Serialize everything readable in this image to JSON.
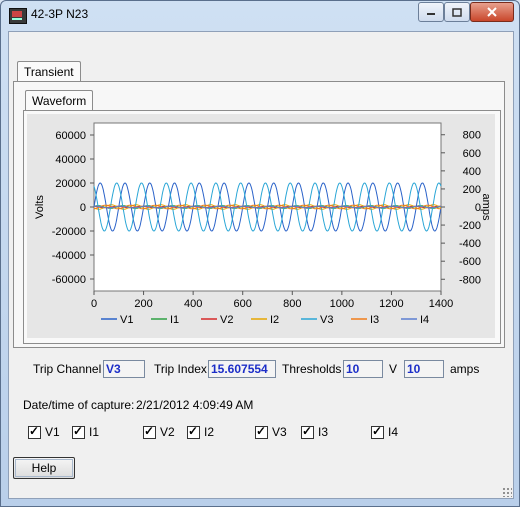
{
  "window": {
    "title": "42-3P N23",
    "controls": [
      "minimize-icon",
      "maximize-icon",
      "close-icon"
    ]
  },
  "tabs": {
    "outer": "Transient",
    "inner": "Waveform"
  },
  "chart_data": {
    "type": "line",
    "left_axis": {
      "label": "Volts",
      "ticks": [
        "60000",
        "40000",
        "20000",
        "0",
        "-20000",
        "-40000",
        "-60000"
      ],
      "ylim": [
        -70000,
        70000
      ]
    },
    "right_axis": {
      "label": "amps",
      "ticks": [
        "800",
        "600",
        "400",
        "200",
        "0",
        "-200",
        "-400",
        "-600",
        "-800"
      ],
      "ylim": [
        -930,
        930
      ]
    },
    "x_axis": {
      "ticks": [
        "0",
        "200",
        "400",
        "600",
        "800",
        "1000",
        "1200",
        "1400"
      ],
      "xlim": [
        0,
        1400
      ]
    },
    "legend": {
      "placement": "bottom"
    },
    "series": [
      {
        "name": "V1",
        "color": "#2a62c9",
        "axis": "left",
        "amplitude": 20000,
        "cycles": 14,
        "phase_deg": 0
      },
      {
        "name": "I1",
        "color": "#2ea043",
        "axis": "right",
        "amplitude": 15,
        "cycles": 14,
        "phase_deg": 30
      },
      {
        "name": "V2",
        "color": "#d62828",
        "axis": "left",
        "amplitude": 600,
        "cycles": 14,
        "phase_deg": 120
      },
      {
        "name": "I2",
        "color": "#e6a700",
        "axis": "right",
        "amplitude": 25,
        "cycles": 14,
        "phase_deg": 200
      },
      {
        "name": "V3",
        "color": "#2aa6d6",
        "axis": "left",
        "amplitude": 20000,
        "cycles": 14,
        "phase_deg": 120
      },
      {
        "name": "I3",
        "color": "#f07d1a",
        "axis": "right",
        "amplitude": 20,
        "cycles": 14,
        "phase_deg": 280
      },
      {
        "name": "I4",
        "color": "#5b7fd0",
        "axis": "right",
        "amplitude": 8,
        "cycles": 14,
        "phase_deg": 60
      }
    ]
  },
  "trip": {
    "channel_label": "Trip Channel",
    "channel_value": "V3",
    "index_label": "Trip Index",
    "index_value": "15.607554",
    "thresholds_label": "Thresholds",
    "threshold_v": "10",
    "v_unit": "V",
    "threshold_a": "10",
    "a_unit": "amps"
  },
  "capture": {
    "label": "Date/time of capture:",
    "value": "2/21/2012 4:09:49 AM"
  },
  "checkboxes": [
    {
      "label": "V1",
      "checked": true
    },
    {
      "label": "I1",
      "checked": true
    },
    {
      "label": "V2",
      "checked": true
    },
    {
      "label": "I2",
      "checked": true
    },
    {
      "label": "V3",
      "checked": true
    },
    {
      "label": "I3",
      "checked": true
    },
    {
      "label": "I4",
      "checked": true
    }
  ],
  "help_label": "Help"
}
